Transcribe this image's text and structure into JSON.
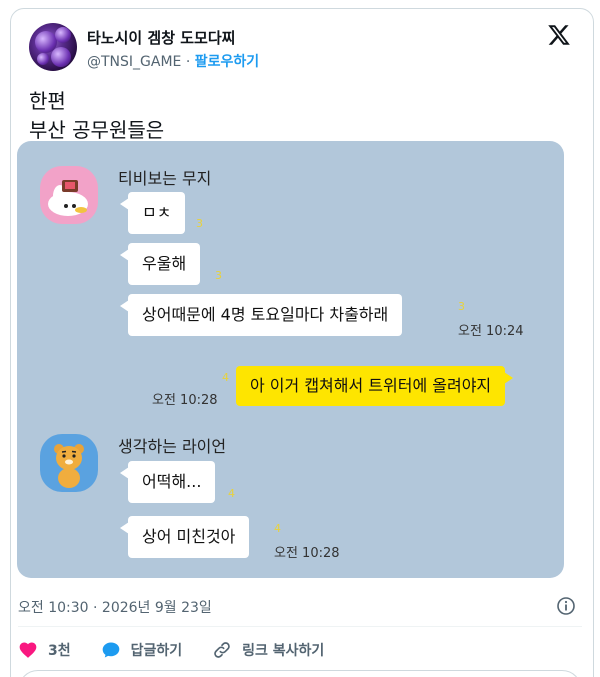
{
  "author": {
    "display_name": "타노시이 겜창 도모다찌",
    "handle": "@TNSI_GAME",
    "separator": "·",
    "follow_label": "팔로우하기"
  },
  "tweet": {
    "line1": "한편",
    "line2": "부산 공무원들은"
  },
  "chat": {
    "sender1": "티비보는 무지",
    "sender2": "생각하는 라이언",
    "messages": {
      "m1": {
        "text": "ㅁㅊ",
        "unread": "3"
      },
      "m2": {
        "text": "우울해",
        "unread": "3"
      },
      "m3": {
        "text": "상어때문에 4명 토요일마다 차출하래",
        "unread": "3",
        "time": "오전 10:24"
      },
      "m4": {
        "text": "아 이거 캡쳐해서 트위터에 올려야지",
        "unread": "4",
        "time": "오전 10:28"
      },
      "m5": {
        "text": "어떡해...",
        "unread": "4"
      },
      "m6": {
        "text": "상어 미친것아",
        "unread": "4",
        "time": "오전 10:28"
      }
    }
  },
  "meta": {
    "timestamp": "오전 10:30 · 2026년 9월 23일"
  },
  "actions": {
    "like_count": "3천",
    "reply_label": "답글하기",
    "copy_link_label": "링크 복사하기"
  },
  "colors": {
    "chat_bg": "#b2c7da",
    "my_bubble": "#fee500",
    "like": "#f91880",
    "reply": "#1d9bf0",
    "follow": "#1d9bf0"
  },
  "icons": [
    "x-logo-icon",
    "info-icon",
    "heart-icon",
    "reply-bubble-icon",
    "link-icon"
  ]
}
